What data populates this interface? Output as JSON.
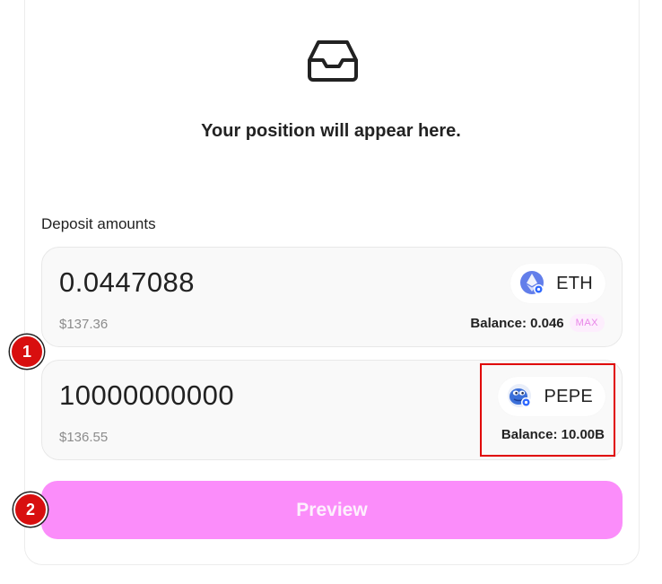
{
  "empty_state": {
    "icon": "inbox-icon",
    "message": "Your position will appear here."
  },
  "deposit": {
    "label": "Deposit amounts",
    "tokens": [
      {
        "amount": "0.0447088",
        "usd": "$137.36",
        "symbol": "ETH",
        "icon": "eth-logo-icon",
        "balance": "Balance: 0.046",
        "max_label": "MAX"
      },
      {
        "amount": "10000000000",
        "usd": "$136.55",
        "symbol": "PEPE",
        "icon": "pepe-logo-icon",
        "balance": "Balance: 10.00B"
      }
    ]
  },
  "annotations": {
    "step1": "1",
    "step2": "2",
    "highlight_color": "#e00000"
  },
  "actions": {
    "preview_label": "Preview"
  },
  "colors": {
    "accent": "#fb8dfa",
    "badge": "#d80f0f"
  }
}
